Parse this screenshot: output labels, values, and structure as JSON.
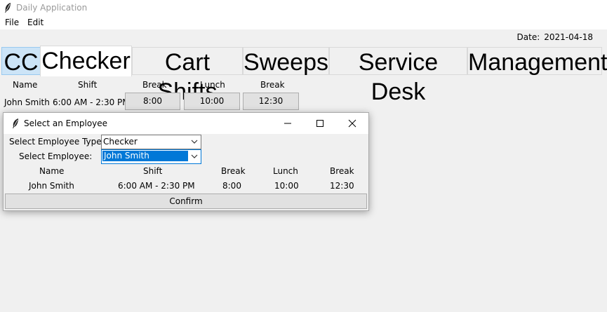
{
  "window": {
    "title": "Daily Application"
  },
  "menu": [
    "File",
    "Edit"
  ],
  "date": {
    "label": "Date:",
    "value": "2021-04-18"
  },
  "tabs": [
    "CC",
    "Checker",
    "Cart Shifts",
    "Sweeps",
    "Service Desk",
    "Management"
  ],
  "active_tab": "Checker",
  "grid": {
    "headers": [
      "Name",
      "Shift",
      "Break",
      "Lunch",
      "Break"
    ],
    "row": {
      "name": "John Smith",
      "shift": "6:00 AM - 2:30 PM",
      "break1": "8:00",
      "lunch": "10:00",
      "break2": "12:30"
    }
  },
  "dialog": {
    "title": "Select an Employee",
    "type_label": "Select Employee Type:",
    "type_value": "Checker",
    "employee_label": "Select Employee:",
    "employee_value": "John Smith",
    "headers": [
      "Name",
      "Shift",
      "Break",
      "Lunch",
      "Break"
    ],
    "row": {
      "name": "John Smith",
      "shift": "6:00 AM - 2:30 PM",
      "break1": "8:00",
      "lunch": "10:00",
      "break2": "12:30"
    },
    "confirm_label": "Confirm"
  },
  "icons": [
    "feather-icon",
    "minimize-icon",
    "maximize-icon",
    "close-icon",
    "chevron-down-icon"
  ],
  "colors": {
    "selection": "#0078d7",
    "active_tab": "#ffffff",
    "first_tab_highlight": "#cce4f7"
  }
}
